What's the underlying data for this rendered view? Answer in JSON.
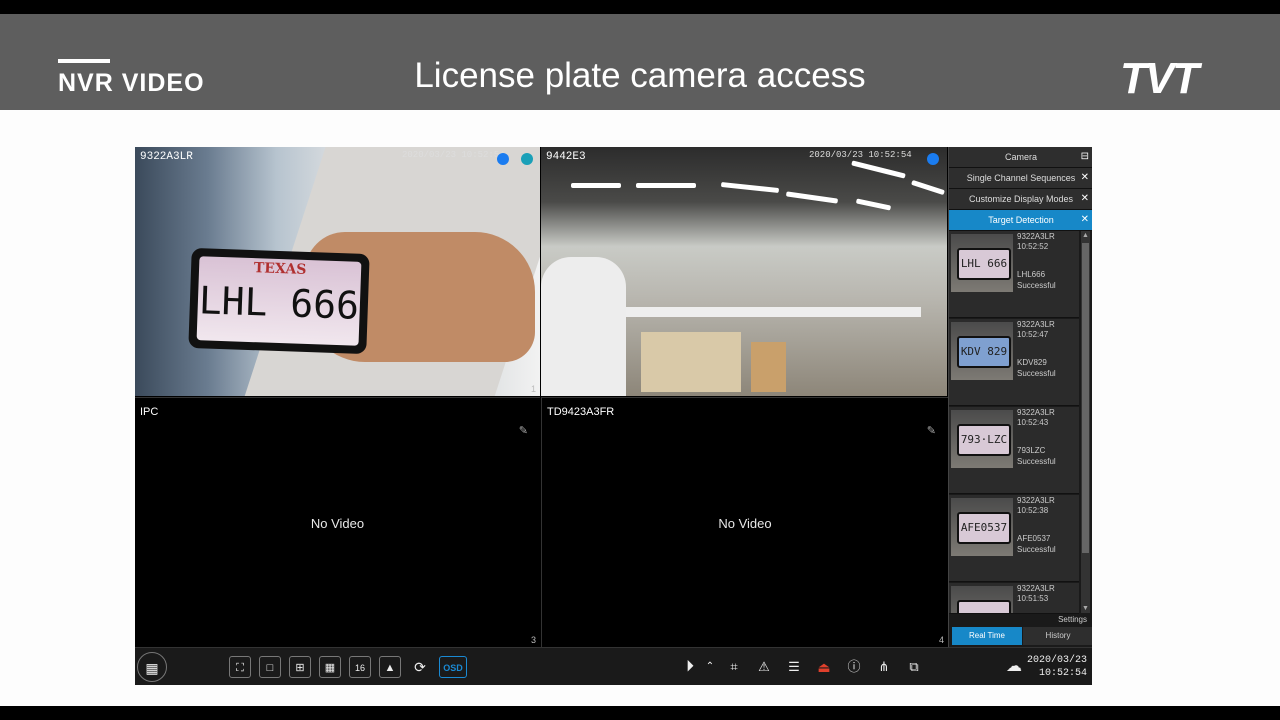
{
  "slide": {
    "brand": "NVR VIDEO",
    "title": "License plate camera access",
    "logo": "TVT"
  },
  "cameras": [
    {
      "label": "9322A3LR",
      "time": "2020/03/23 10:52:54",
      "num": "1"
    },
    {
      "label": "9442E3",
      "time": "2020/03/23 10:52:54",
      "num": ""
    },
    {
      "label": "IPC",
      "status": "No Video",
      "num": "3"
    },
    {
      "label": "TD9423A3FR",
      "status": "No Video",
      "num": "4"
    }
  ],
  "scene": {
    "plate_state": "TEXAS",
    "plate_number": "LHL 666"
  },
  "panel": {
    "tabs": [
      "Camera",
      "Single Channel Sequences",
      "Customize Display Modes",
      "Target Detection"
    ],
    "entries": [
      {
        "camera": "9322A3LR",
        "time": "10:52:52",
        "plate": "LHL666",
        "status": "Successful",
        "thumb": "LHL 666"
      },
      {
        "camera": "9322A3LR",
        "time": "10:52:47",
        "plate": "KDV829",
        "status": "Successful",
        "thumb": "KDV 829"
      },
      {
        "camera": "9322A3LR",
        "time": "10:52:43",
        "plate": "793LZC",
        "status": "Successful",
        "thumb": "793·LZC"
      },
      {
        "camera": "9322A3LR",
        "time": "10:52:38",
        "plate": "AFE0537",
        "status": "Successful",
        "thumb": "AFE0537"
      },
      {
        "camera": "9322A3LR",
        "time": "10:51:53",
        "plate": "",
        "status": "",
        "thumb": ""
      }
    ],
    "settings": "Settings",
    "bottom_tabs": [
      "Real Time",
      "History"
    ]
  },
  "toolbar": {
    "osd": "OSD",
    "date": "2020/03/23",
    "time": "10:52:54"
  },
  "colors": {
    "accent": "#1788c8",
    "banner": "#5e5e5e"
  }
}
